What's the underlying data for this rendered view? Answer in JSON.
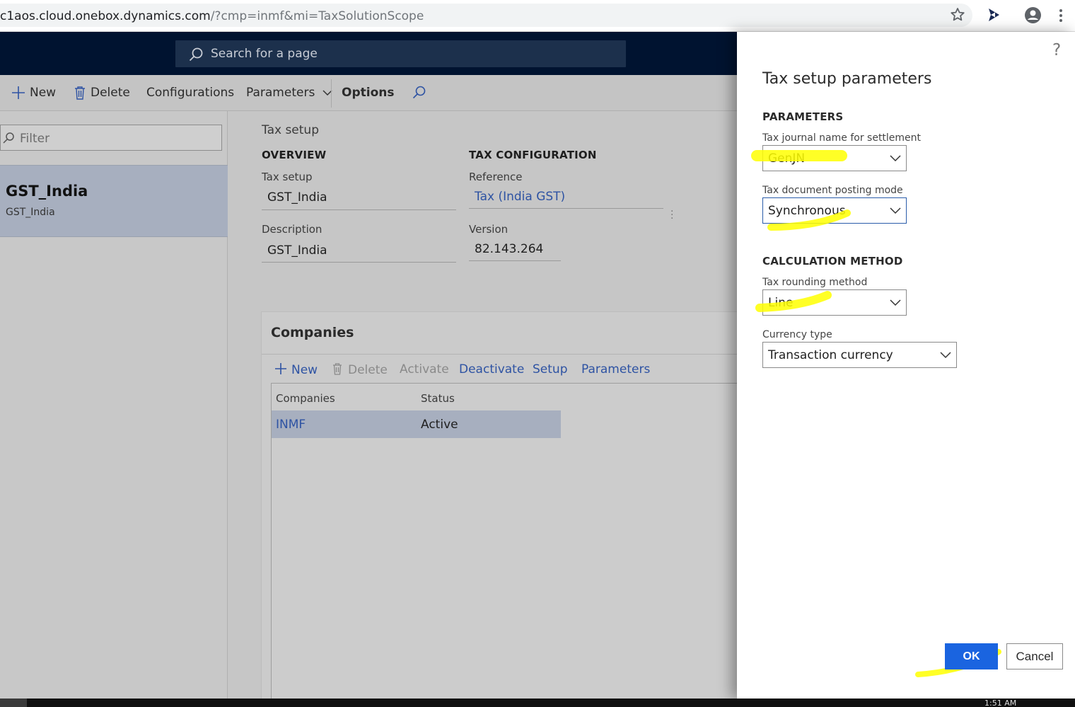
{
  "browser": {
    "url_host": "c1aos.cloud.onebox.dynamics.com",
    "url_rest": "/?cmp=inmf&mi=TaxSolutionScope"
  },
  "app": {
    "search_placeholder": "Search for a page",
    "actions": {
      "new": "New",
      "delete": "Delete",
      "configurations": "Configurations",
      "parameters": "Parameters",
      "options": "Options"
    },
    "filter_placeholder": "Filter",
    "list": [
      {
        "title": "GST_India",
        "subtitle": "GST_India"
      }
    ],
    "detail": {
      "section_title": "Tax setup",
      "overview_header": "OVERVIEW",
      "tax_config_header": "TAX CONFIGURATION",
      "tax_setup_label": "Tax setup",
      "tax_setup_value": "GST_India",
      "description_label": "Description",
      "description_value": "GST_India",
      "reference_label": "Reference",
      "reference_value": "Tax (India GST)",
      "version_label": "Version",
      "version_value": "82.143.264"
    },
    "companies": {
      "title": "Companies",
      "actions": {
        "new": "New",
        "delete": "Delete",
        "activate": "Activate",
        "deactivate": "Deactivate",
        "setup": "Setup",
        "parameters": "Parameters"
      },
      "columns": [
        "Companies",
        "Status"
      ],
      "rows": [
        {
          "company": "INMF",
          "status": "Active"
        }
      ]
    }
  },
  "dialog": {
    "help": "?",
    "title": "Tax setup parameters",
    "parameters_header": "PARAMETERS",
    "journal_label": "Tax journal name for settlement",
    "journal_value": "GenJN",
    "posting_mode_label": "Tax document posting mode",
    "posting_mode_value": "Synchronous",
    "calc_header": "CALCULATION METHOD",
    "rounding_label": "Tax rounding method",
    "rounding_value": "Line",
    "currency_label": "Currency type",
    "currency_value": "Transaction currency",
    "ok": "OK",
    "cancel": "Cancel"
  },
  "taskbar": {
    "time": "1:51 AM"
  },
  "colors": {
    "nav": "#001330",
    "link": "#2e53a3",
    "selected_row": "#a7afbf",
    "primary_button": "#1a64e0",
    "highlighter": "#ffff00"
  }
}
